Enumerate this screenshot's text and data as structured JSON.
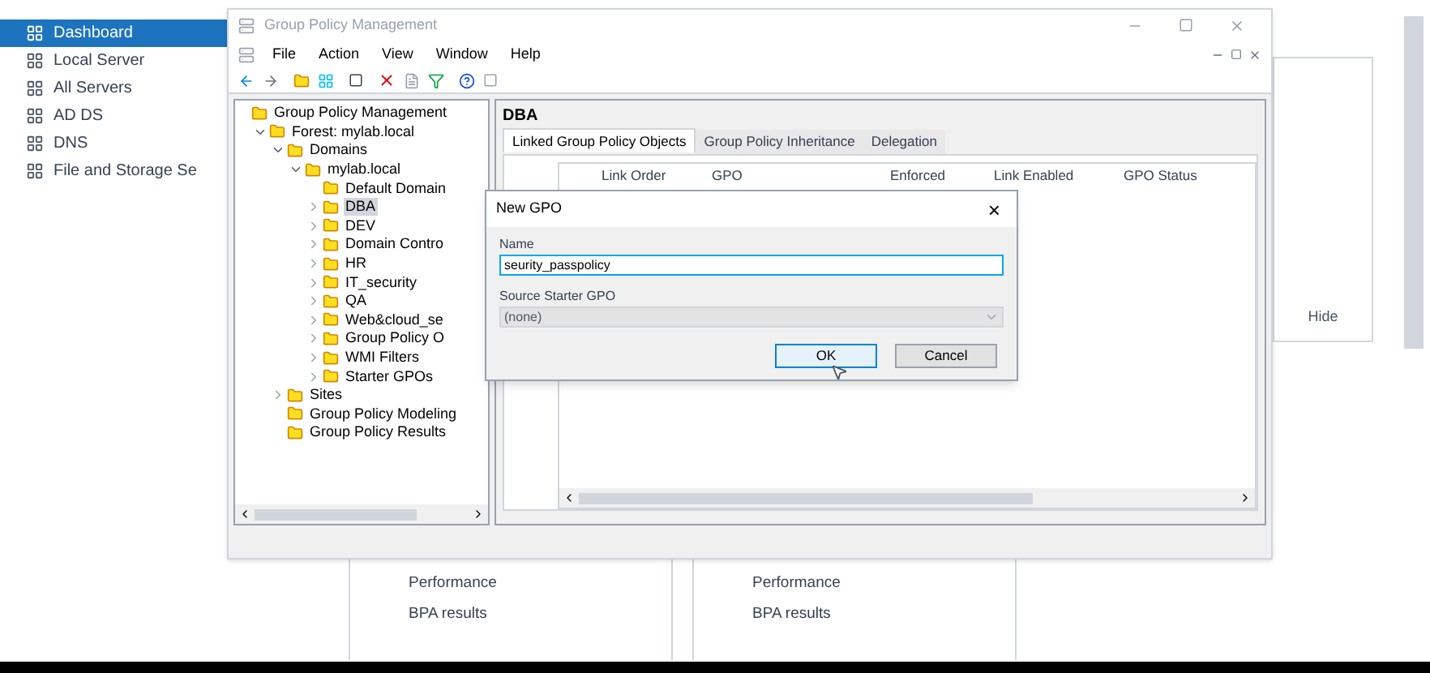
{
  "server_manager": {
    "nav": [
      {
        "label": "Dashboard",
        "selected": true
      },
      {
        "label": "Local Server",
        "selected": false
      },
      {
        "label": "All Servers",
        "selected": false
      },
      {
        "label": "AD DS",
        "selected": false
      },
      {
        "label": "DNS",
        "selected": false
      },
      {
        "label": "File and Storage Se",
        "selected": false
      }
    ],
    "hide_button": "Hide",
    "tiles": [
      {
        "items": [
          "Performance",
          "BPA results"
        ]
      },
      {
        "items": [
          "Performance",
          "BPA results"
        ]
      }
    ]
  },
  "window": {
    "title": "Group Policy Management",
    "menu": [
      "File",
      "Action",
      "View",
      "Window",
      "Help"
    ],
    "tree": [
      {
        "label": "Group Policy Management",
        "children": [
          {
            "label": "Forest: mylab.local",
            "expanded": true,
            "children": [
              {
                "label": "Domains",
                "expanded": true,
                "children": [
                  {
                    "label": "mylab.local",
                    "expanded": true,
                    "children": [
                      {
                        "label": "Default Domain",
                        "selected": false
                      },
                      {
                        "label": "DBA",
                        "expanded": false,
                        "selected": true
                      },
                      {
                        "label": "DEV",
                        "expanded": false,
                        "selected": false
                      },
                      {
                        "label": "Domain Contro",
                        "expanded": false,
                        "selected": false
                      },
                      {
                        "label": "HR",
                        "expanded": false,
                        "selected": false
                      },
                      {
                        "label": "IT_security",
                        "expanded": false,
                        "selected": false
                      },
                      {
                        "label": "QA",
                        "expanded": false,
                        "selected": false
                      },
                      {
                        "label": "Web&cloud_se",
                        "expanded": false,
                        "selected": false
                      },
                      {
                        "label": "Group Policy O",
                        "expanded": false,
                        "selected": false
                      },
                      {
                        "label": "WMI Filters",
                        "expanded": false,
                        "selected": false
                      },
                      {
                        "label": "Starter GPOs",
                        "expanded": false,
                        "selected": false
                      }
                    ]
                  }
                ]
              },
              {
                "label": "Sites",
                "expanded": false
              },
              {
                "label": "Group Policy Modeling"
              },
              {
                "label": "Group Policy Results"
              }
            ]
          }
        ]
      }
    ],
    "heading": "DBA",
    "tabs": [
      {
        "label": "Linked Group Policy Objects",
        "selected": true
      },
      {
        "label": "Group Policy Inheritance",
        "selected": false
      },
      {
        "label": "Delegation",
        "selected": false
      }
    ],
    "table": {
      "columns": [
        "Link Order",
        "GPO",
        "Enforced",
        "Link Enabled",
        "GPO Status"
      ]
    }
  },
  "dialog": {
    "title": "New GPO",
    "close": "×",
    "name_label": "Name",
    "name_value": "seurity_passpolicy",
    "source_label": "Source Starter GPO",
    "source_value": "(none)",
    "source_disabled": true,
    "buttons": [
      {
        "label": "OK",
        "focused": true
      },
      {
        "label": "Cancel",
        "focused": false
      }
    ]
  }
}
